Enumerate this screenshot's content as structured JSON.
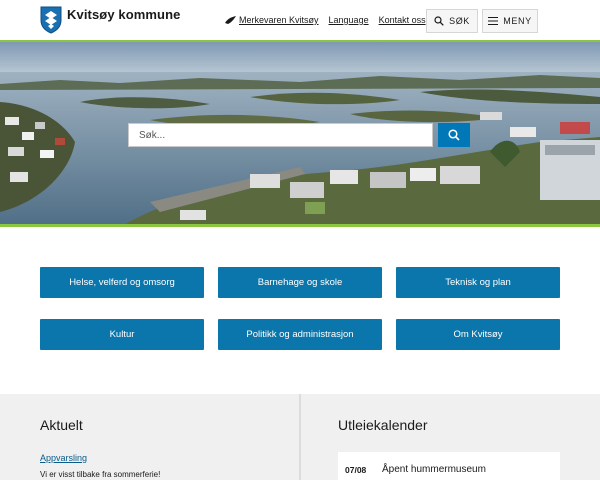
{
  "header": {
    "logo_text": "Kvitsøy kommune",
    "links": [
      "Merkevaren Kvitsøy",
      "Language",
      "Kontakt oss"
    ],
    "search_label": "SØK",
    "menu_label": "MENY"
  },
  "hero": {
    "search_placeholder": "Søk..."
  },
  "tiles": [
    "Helse, velferd og omsorg",
    "Barnehage og skole",
    "Teknisk og plan",
    "Kultur",
    "Politikk og administrasjon",
    "Om Kvitsøy"
  ],
  "news": {
    "heading": "Aktuelt",
    "item_title": "Appvarsling",
    "item_text": "Vi er visst tilbake fra sommerferie!"
  },
  "calendar": {
    "heading": "Utleiekalender",
    "item_date": "07/08",
    "item_title": "Åpent hummermuseum"
  },
  "colors": {
    "accent_green": "#8cc63f",
    "tile_blue": "#0a76ab",
    "search_blue": "#0077b6"
  }
}
